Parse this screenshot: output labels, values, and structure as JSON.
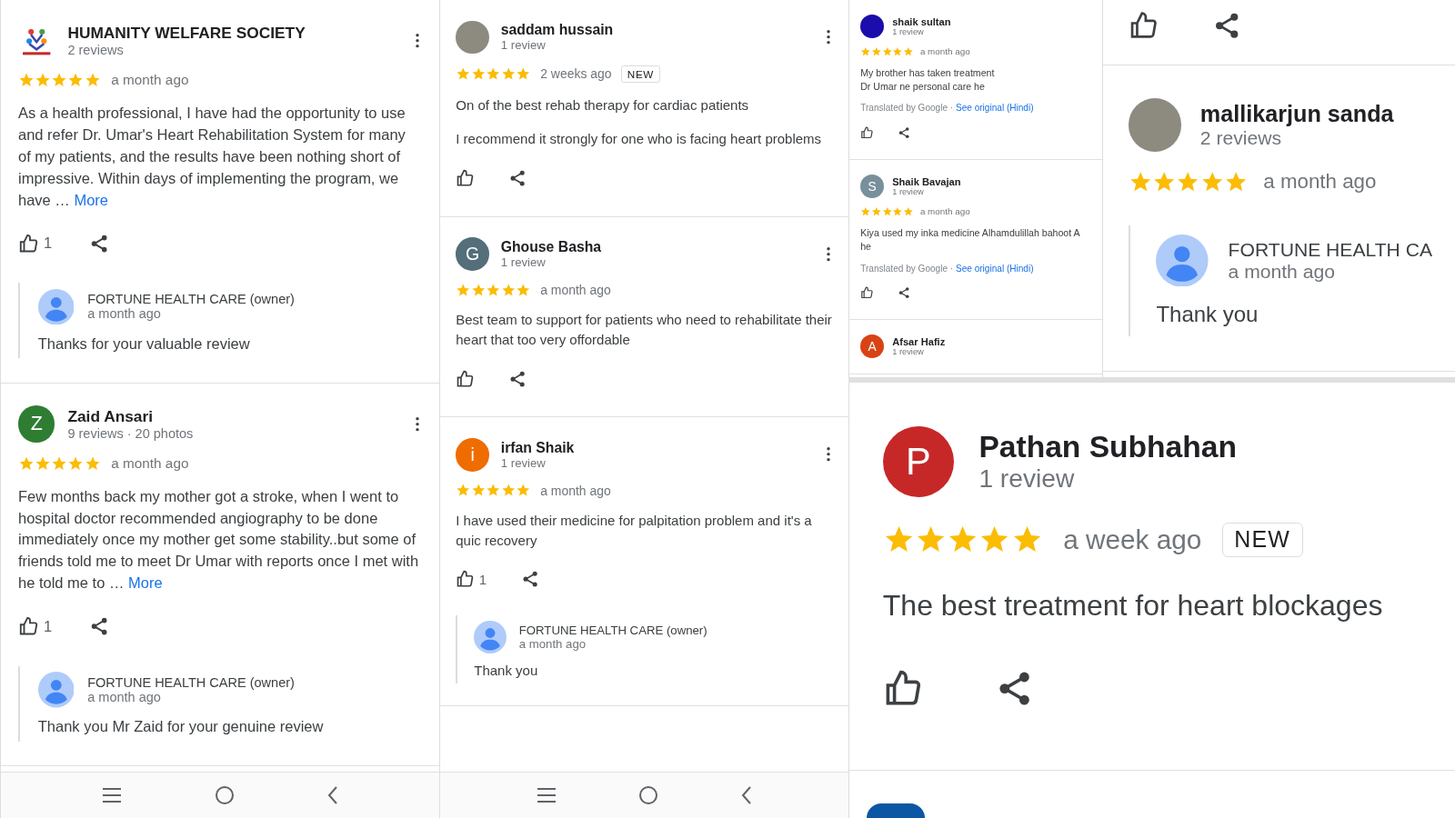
{
  "panels": [
    {
      "nav": true,
      "items": [
        {
          "kind": "review",
          "avatar": {
            "kind": "logo"
          },
          "name": "HUMANITY WELFARE SOCIETY",
          "meta": "2 reviews",
          "menu": true,
          "stars": 5,
          "time": "a month ago",
          "text": "As a health professional, I have had the opportunity to use and refer Dr. Umar's Heart Rehabilitation System for many of my patients, and the results have been nothing short of impressive. Within days of implementing the program, we have …",
          "more": "More",
          "likes": "1",
          "reply": {
            "owner": "FORTUNE HEALTH CARE (owner)",
            "time": "a month ago",
            "text": "Thanks for your valuable review"
          }
        },
        {
          "kind": "review",
          "avatar": {
            "kind": "letter",
            "letter": "Z",
            "color": "#2e7d32"
          },
          "name": "Zaid Ansari",
          "meta": "9 reviews · 20 photos",
          "menu": true,
          "stars": 5,
          "time": "a month ago",
          "text": "Few months back my mother got a stroke, when I went to hospital doctor recommended angiography to be done immediately once my mother get some stability..but some of friends told me to meet Dr Umar with reports once I met with he told me to …",
          "more": "More",
          "likes": "1",
          "reply": {
            "owner": "FORTUNE HEALTH CARE (owner)",
            "time": "a month ago",
            "text": "Thank you Mr Zaid for your genuine review"
          }
        }
      ]
    },
    {
      "nav": true,
      "items": [
        {
          "kind": "review",
          "avatar": {
            "kind": "photo"
          },
          "name": "saddam hussain",
          "meta": "1 review",
          "menu": true,
          "stars": 5,
          "time": "2 weeks ago",
          "badge": "NEW",
          "text": "On of the best rehab therapy for cardiac patients",
          "text2": "I recommend it strongly for one who is facing heart problems"
        },
        {
          "kind": "review",
          "avatar": {
            "kind": "letter",
            "letter": "G",
            "color": "#546e7a"
          },
          "name": "Ghouse Basha",
          "meta": "1 review",
          "menu": true,
          "stars": 5,
          "time": "a month ago",
          "text": "Best team to support for patients who need to rehabilitate their heart that too very offordable"
        },
        {
          "kind": "review",
          "avatar": {
            "kind": "letter",
            "letter": "i",
            "color": "#ef6c00"
          },
          "name": "irfan Shaik",
          "meta": "1 review",
          "menu": true,
          "stars": 5,
          "time": "a month ago",
          "text": "I have used their medicine for palpitation problem and it's a quic recovery",
          "likes": "1",
          "reply": {
            "owner": "FORTUNE HEALTH CARE (owner)",
            "time": "a month ago",
            "text": "Thank you"
          }
        }
      ]
    },
    {
      "nav": false,
      "items": [
        {
          "kind": "review",
          "avatar": {
            "kind": "plain",
            "color": "#1a0dab"
          },
          "name": "shaik sultan",
          "meta": "1 review",
          "menu": false,
          "stars": 5,
          "time": "a month ago",
          "text": "My brother has taken treatment\nDr Umar ne personal care he",
          "translation": {
            "label": "Translated by Google · ",
            "link": "See original (Hindi)"
          }
        },
        {
          "kind": "review",
          "avatar": {
            "kind": "letter",
            "letter": "S",
            "color": "#78909c"
          },
          "name": "Shaik Bavajan",
          "meta": "1 review",
          "menu": false,
          "stars": 5,
          "time": "a month ago",
          "text": "Kiya used my inka medicine Alhamdulillah bahoot A he",
          "translation": {
            "label": "Translated by Google · ",
            "link": "See original (Hindi)"
          }
        },
        {
          "kind": "header",
          "avatar": {
            "kind": "letter",
            "letter": "A",
            "color": "#d84315"
          },
          "name": "Afsar Hafiz",
          "meta": "1 review"
        }
      ]
    },
    {
      "nav": false,
      "items": [
        {
          "kind": "actions"
        },
        {
          "kind": "review",
          "avatar": {
            "kind": "photo"
          },
          "name": "mallikarjun sanda",
          "meta": "2 reviews",
          "menu": false,
          "stars": 5,
          "time": "a month ago",
          "reply": {
            "owner": "FORTUNE HEALTH CA",
            "time": "a month ago",
            "text": "Thank you"
          },
          "noActions": true
        }
      ]
    },
    {
      "nav": false,
      "items": [
        {
          "kind": "review",
          "avatar": {
            "kind": "letter",
            "letter": "P",
            "color": "#c62828"
          },
          "name": "Pathan Subhahan",
          "meta": "1 review",
          "menu": false,
          "stars": 5,
          "time": "a week ago",
          "badge": "NEW",
          "text": "The best treatment for heart blockages"
        },
        {
          "kind": "stub",
          "color": "#0b57a4"
        }
      ]
    }
  ]
}
